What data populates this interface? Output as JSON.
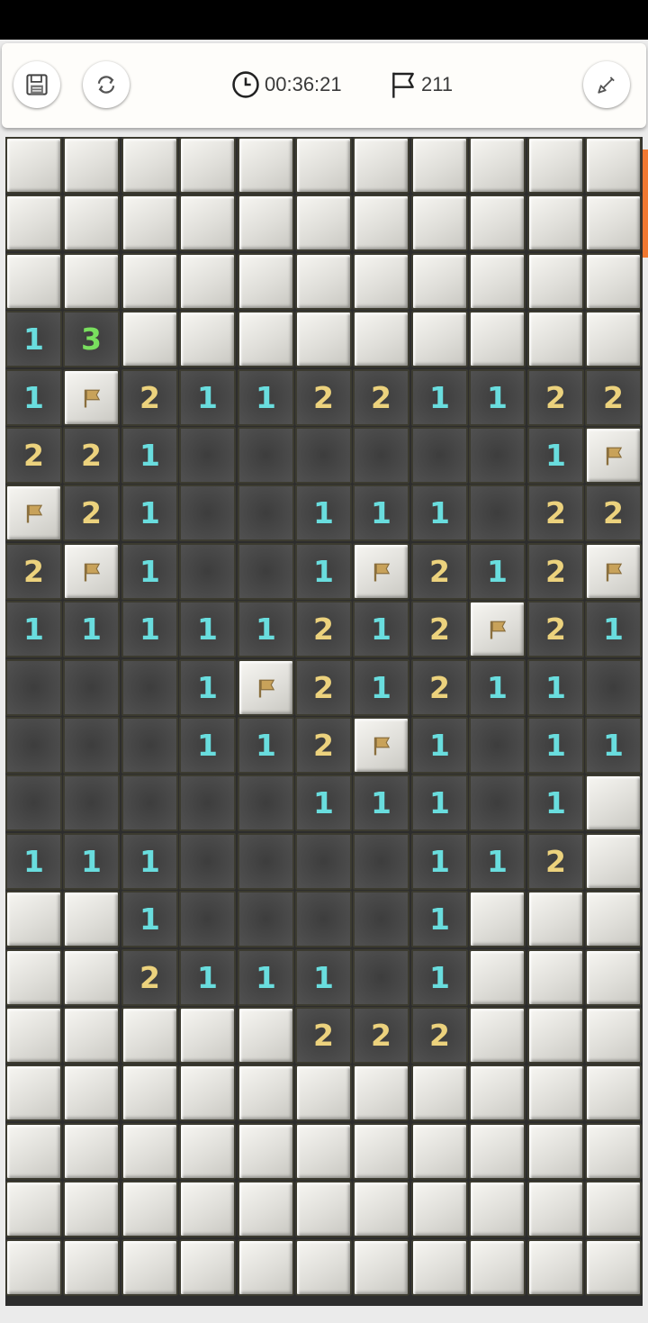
{
  "toolbar": {
    "timer": "00:36:21",
    "flags_remaining": "211",
    "icons": [
      "save-icon",
      "restart-icon",
      "clock-icon",
      "flag-icon",
      "shovel-icon"
    ]
  },
  "board": {
    "columns": 11,
    "visible_rows": 20,
    "legend": "#=unrevealed, F=flagged, .=revealed empty, digit=revealed number",
    "rows": [
      "###########",
      "###########",
      "###########",
      "13#########",
      "1F211221122",
      "221......1F",
      "F21..111.22",
      "2F1..1F212F",
      "11111212F21",
      "...1F21211.",
      "...112F1.11",
      ".....111.1#",
      "111....112#",
      "##1....1###",
      "##2111.1###",
      "#####222###",
      "###########",
      "###########",
      "###########",
      "###########"
    ]
  },
  "colors": {
    "number_1": "#69ddde",
    "number_2": "#ecd27d",
    "number_3": "#79df5e",
    "flag": "#c8a25a",
    "scroll_accent": "#f07830"
  }
}
